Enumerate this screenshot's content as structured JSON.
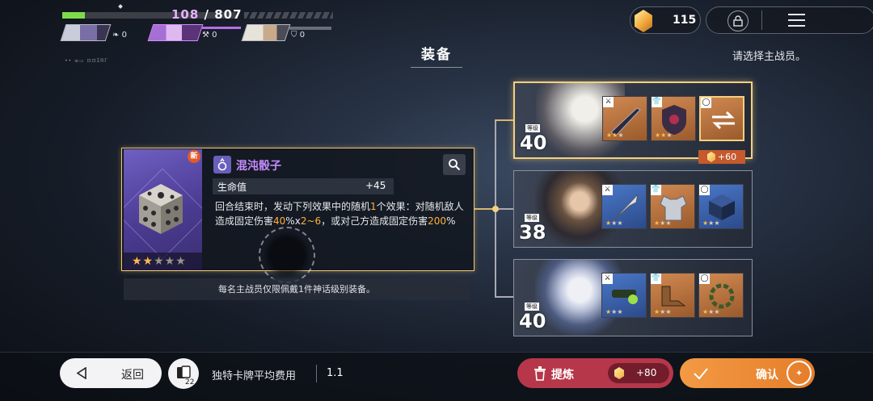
{
  "hud": {
    "hp_current": "108",
    "hp_sep": " / ",
    "hp_max": "807",
    "hp_fill_percent": 13,
    "party": [
      {
        "stat": "0",
        "icon": "bird-icon"
      },
      {
        "stat": "0",
        "icon": "sword-icon"
      },
      {
        "stat": "0",
        "icon": "shield-icon"
      }
    ]
  },
  "currency": {
    "value": "115"
  },
  "header": {
    "title": "装备",
    "hint": "请选择主战员。",
    "small_text": "•• ≡▭ ⊡⊡ΣᏒΓ"
  },
  "item": {
    "badge": "新",
    "name": "混沌骰子",
    "stat_label": "生命值",
    "stat_value": "+45",
    "desc_1": "回合结束时，发动下列效果中的随机",
    "desc_n1": "1",
    "desc_2": "个效果：对随机敌人造成固定伤害",
    "desc_p1": "40",
    "desc_3": "%x",
    "desc_r": "2~6",
    "desc_4": "，或对己方造成固定伤害",
    "desc_p2": "200",
    "desc_5": "%",
    "stars_on": "★★",
    "stars_off": "★★★",
    "rarity_stars": 2,
    "rarity_max": 5
  },
  "note": "每名主战员仅限佩戴1件神话级别装备。",
  "characters": [
    {
      "level_label": "等级",
      "level": "40",
      "bonus": "+60",
      "selected": true
    },
    {
      "level_label": "等级",
      "level": "38",
      "selected": false
    },
    {
      "level_label": "等级",
      "level": "40",
      "selected": false
    }
  ],
  "slot_tags": {
    "weapon": "⚔",
    "armor": "👕",
    "ring": "◯"
  },
  "bottom": {
    "back_label": "返回",
    "card_count": "22",
    "cost_label": "独特卡牌平均费用",
    "cost_value": "1.1",
    "refine_label": "提炼",
    "refine_value": "+80",
    "confirm_label": "确认"
  },
  "colors": {
    "accent_gold": "#f4d07e",
    "refine_red": "#b6374a",
    "confirm_orange": "#f39a44",
    "item_purple": "#c48cff",
    "highlight": "#ffb13c"
  }
}
